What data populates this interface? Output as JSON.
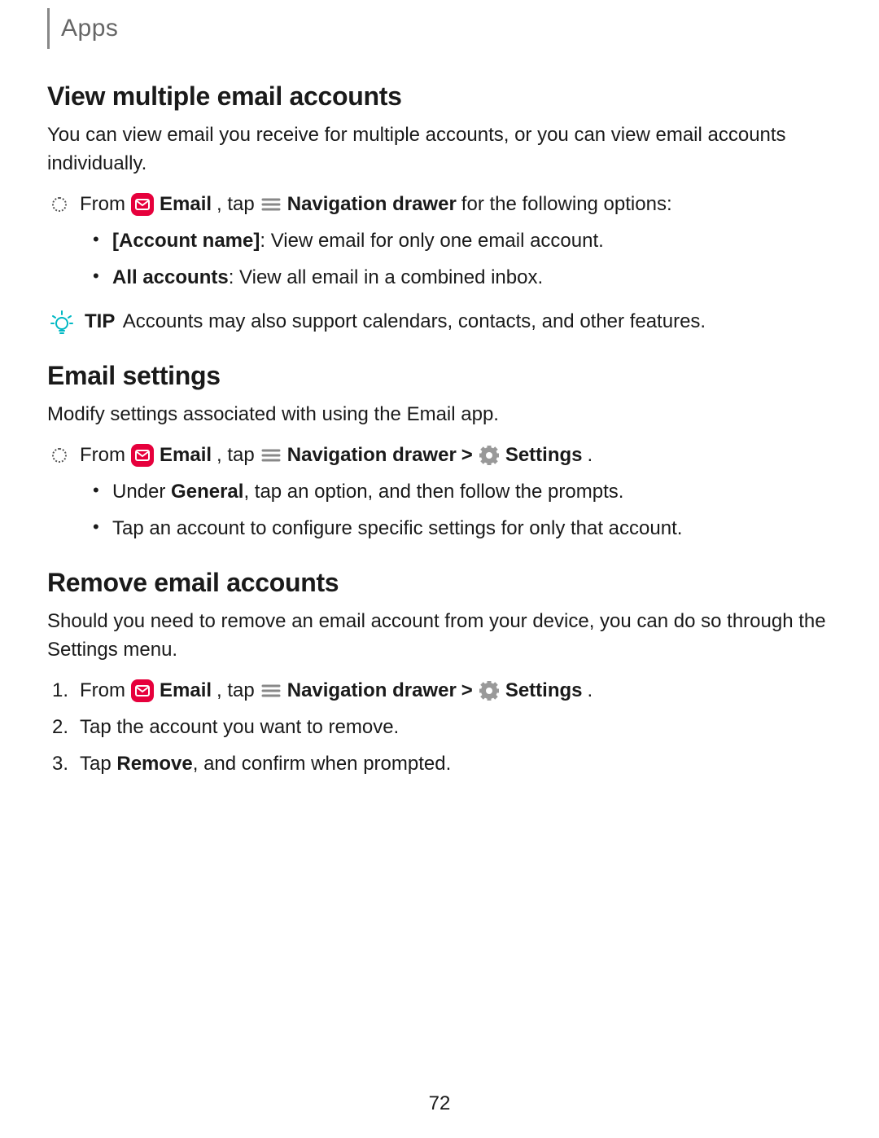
{
  "header": {
    "breadcrumb": "Apps"
  },
  "sections": {
    "viewMultiple": {
      "title": "View multiple email accounts",
      "intro": "You can view email you receive for multiple accounts, or you can view email accounts individually.",
      "instr": {
        "from": "From",
        "emailLabel": "Email",
        "tap": ", tap",
        "navDrawer": "Navigation drawer",
        "tail": " for the following options:"
      },
      "bullets": {
        "accountNameBold": "[Account name]",
        "accountNameRest": ": View email for only one email account.",
        "allAccountsBold": "All accounts",
        "allAccountsRest": ": View all email in a combined inbox."
      },
      "tip": {
        "label": "TIP",
        "text": "Accounts may also support calendars, contacts, and other features."
      }
    },
    "emailSettings": {
      "title": "Email settings",
      "intro": "Modify settings associated with using the Email app.",
      "instr": {
        "from": "From",
        "emailLabel": "Email",
        "tap": ", tap",
        "navDrawer": "Navigation drawer",
        "chev": ">",
        "settingsLabel": "Settings",
        "period": "."
      },
      "bullets": {
        "generalPrefix": "Under ",
        "generalBold": "General",
        "generalRest": ", tap an option, and then follow the prompts.",
        "accountLine": "Tap an account to configure specific settings for only that account."
      }
    },
    "removeAccounts": {
      "title": "Remove email accounts",
      "intro": "Should you need to remove an email account from your device, you can do so through the Settings menu.",
      "steps": {
        "s1": {
          "num": "1.",
          "from": "From",
          "emailLabel": "Email",
          "tap": ", tap",
          "navDrawer": "Navigation drawer",
          "chev": ">",
          "settingsLabel": "Settings",
          "period": "."
        },
        "s2": {
          "num": "2.",
          "text": "Tap the account you want to remove."
        },
        "s3": {
          "num": "3.",
          "prefix": "Tap ",
          "removeBold": "Remove",
          "rest": ", and confirm when prompted."
        }
      }
    }
  },
  "pageNumber": "72"
}
